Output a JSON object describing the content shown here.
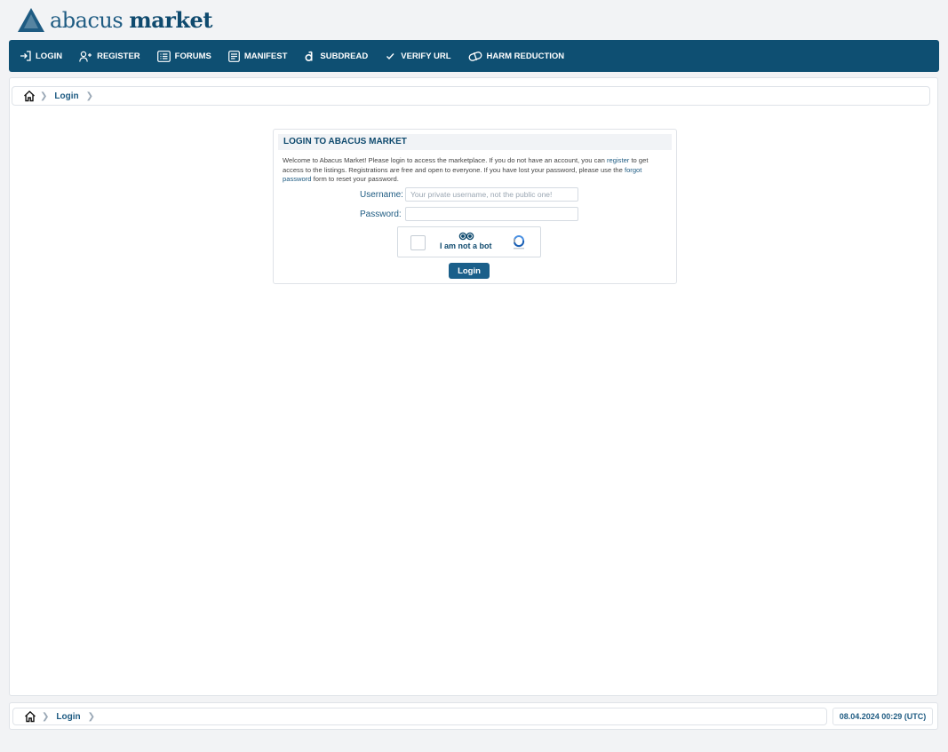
{
  "brand": {
    "name_light": "abacus ",
    "name_bold": "market"
  },
  "nav": {
    "items": [
      {
        "label": "LOGIN",
        "icon": "login-icon"
      },
      {
        "label": "REGISTER",
        "icon": "add-user-icon"
      },
      {
        "label": "FORUMS",
        "icon": "list-icon"
      },
      {
        "label": "MANIFEST",
        "icon": "document-icon"
      },
      {
        "label": "SUBDREAD",
        "icon": "subdread-icon"
      },
      {
        "label": "VERIFY URL",
        "icon": "check-icon"
      },
      {
        "label": "HARM REDUCTION",
        "icon": "pill-icon"
      }
    ]
  },
  "breadcrumb": {
    "current": "Login"
  },
  "login": {
    "title": "LOGIN TO ABACUS MARKET",
    "intro_1": "Welcome to Abacus Market! Please login to access the marketplace. If you do not have an account, you can ",
    "register_link": "register",
    "intro_2": " to get access to the listings. Registrations are free and open to everyone. If you have lost your password, please use the ",
    "forgot_link": "forgot password",
    "intro_3": " form to reset your password.",
    "username_label": "Username:",
    "username_placeholder": "Your private username, not the public one!",
    "username_value": "",
    "password_label": "Password:",
    "password_value": "",
    "captcha_label": "I am not a bot",
    "submit_label": "Login"
  },
  "footer": {
    "breadcrumb_current": "Login",
    "timestamp": "08.04.2024 00:29 (UTC)"
  },
  "colors": {
    "nav_bg": "#0e4f72",
    "accent": "#1e5b82",
    "button": "#1a5f8a"
  }
}
